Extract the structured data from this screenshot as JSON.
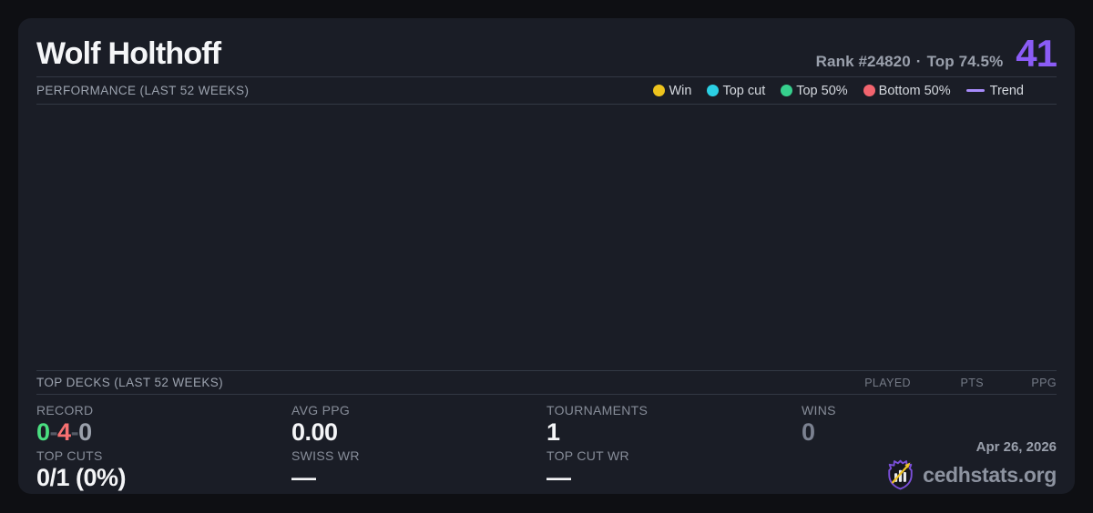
{
  "header": {
    "player_name": "Wolf Holthoff",
    "rank_label": "Rank #24820",
    "separator": "·",
    "top_percent": "Top 74.5%",
    "score": "41"
  },
  "performance": {
    "title": "PERFORMANCE (LAST 52 WEEKS)",
    "legend": {
      "win": {
        "label": "Win",
        "color": "#edc31d"
      },
      "top_cut": {
        "label": "Top cut",
        "color": "#2bd0e4"
      },
      "top50": {
        "label": "Top 50%",
        "color": "#36d08d"
      },
      "bottom50": {
        "label": "Bottom 50%",
        "color": "#f2646e"
      },
      "trend": {
        "label": "Trend",
        "color": "#a78bfa"
      }
    },
    "chart_points": []
  },
  "top_decks": {
    "title": "TOP DECKS (LAST 52 WEEKS)",
    "columns": {
      "played": "PLAYED",
      "pts": "PTS",
      "ppg": "PPG"
    },
    "rows": []
  },
  "stats": {
    "record": {
      "label": "RECORD",
      "wins": "0",
      "losses": "4",
      "draws": "0",
      "separator": "-"
    },
    "avg_ppg": {
      "label": "AVG PPG",
      "value": "0.00"
    },
    "tournaments": {
      "label": "TOURNAMENTS",
      "value": "1"
    },
    "wins": {
      "label": "WINS",
      "value": "0"
    },
    "top_cuts": {
      "label": "TOP CUTS",
      "value": "0/1 (0%)"
    },
    "swiss_wr": {
      "label": "SWISS WR",
      "value": "—"
    },
    "top_cut_wr": {
      "label": "TOP CUT WR",
      "value": "—"
    }
  },
  "footer": {
    "date": "Apr 26, 2026",
    "brand": "cedhstats.org"
  },
  "colors": {
    "page_background": "#0e0f13",
    "card_background": "#1a1d26",
    "accent_purple": "#8b5cf6",
    "record_win_green": "#4ade80",
    "record_loss_red": "#f87171",
    "muted_text": "#9ca3af",
    "divider": "#323844",
    "logo_shield_purple": "#7a4fd8",
    "logo_arrow_yellow": "#f0c428"
  }
}
